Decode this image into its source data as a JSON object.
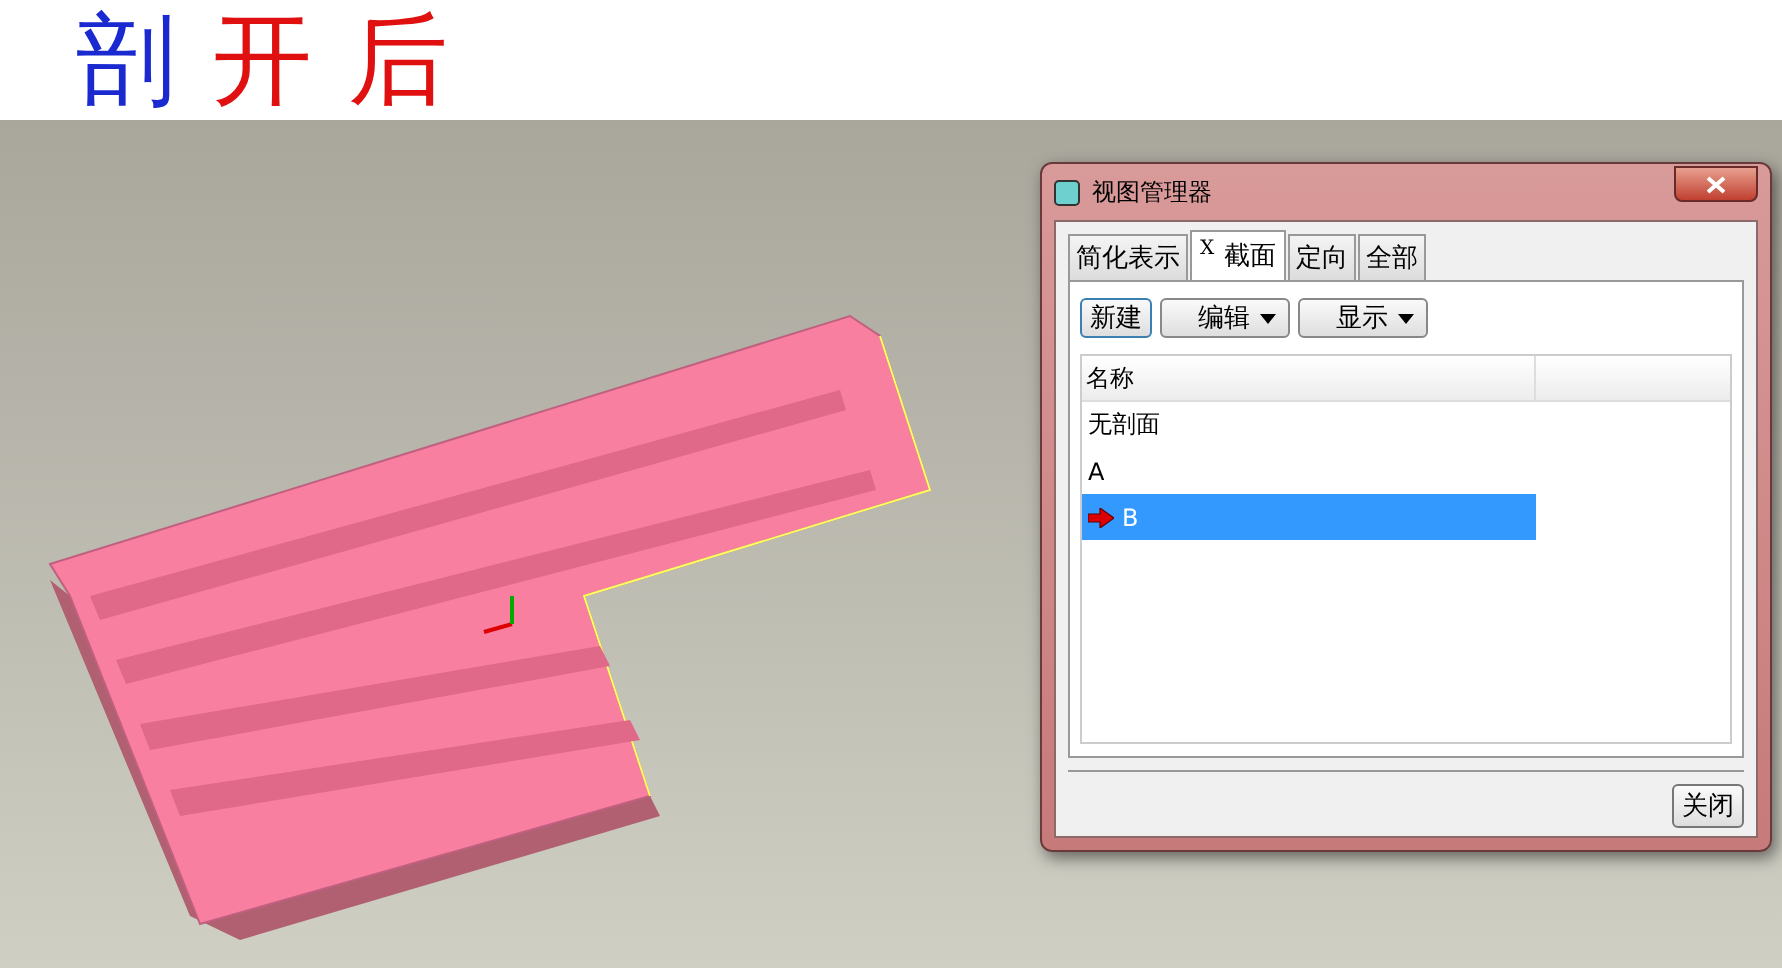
{
  "annotation": {
    "text": "剖开后"
  },
  "dialog": {
    "title": "视图管理器",
    "tabs": [
      {
        "label": "简化表示",
        "selected": false
      },
      {
        "label": "截面",
        "mark": "X",
        "selected": true
      },
      {
        "label": "定向",
        "selected": false
      },
      {
        "label": "全部",
        "selected": false
      }
    ],
    "toolbar": [
      {
        "label": "新建",
        "kind": "button"
      },
      {
        "label": "编辑",
        "kind": "menu"
      },
      {
        "label": "显示",
        "kind": "menu"
      }
    ],
    "table": {
      "columns": [
        "名称"
      ],
      "rows": [
        {
          "name": "无剖面",
          "selected": false,
          "active": false
        },
        {
          "name": "A",
          "selected": false,
          "active": false
        },
        {
          "name": "B",
          "selected": true,
          "active": true
        }
      ]
    },
    "footer_button": "关闭"
  }
}
